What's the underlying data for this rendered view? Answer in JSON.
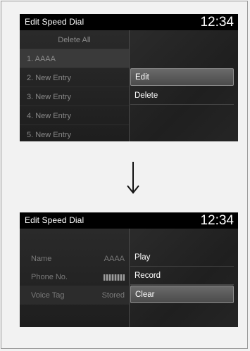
{
  "screen1": {
    "title": "Edit Speed Dial",
    "clock": "12:34",
    "list": [
      "Delete All",
      "1. AAAA",
      "2. New Entry",
      "3. New Entry",
      "4. New Entry",
      "5. New Entry"
    ],
    "selected_index": 1,
    "options": [
      "Edit",
      "Delete"
    ],
    "highlighted_option": "Edit"
  },
  "screen2": {
    "title": "Edit Speed Dial",
    "clock": "12:34",
    "fields": [
      {
        "label": "Name",
        "value": "AAAA"
      },
      {
        "label": "Phone No.",
        "value": ""
      },
      {
        "label": "Voice Tag",
        "value": "Stored"
      }
    ],
    "options": [
      "Play",
      "Record",
      "Clear"
    ],
    "highlighted_option": "Clear"
  },
  "arrow_icon": "down-arrow-icon"
}
